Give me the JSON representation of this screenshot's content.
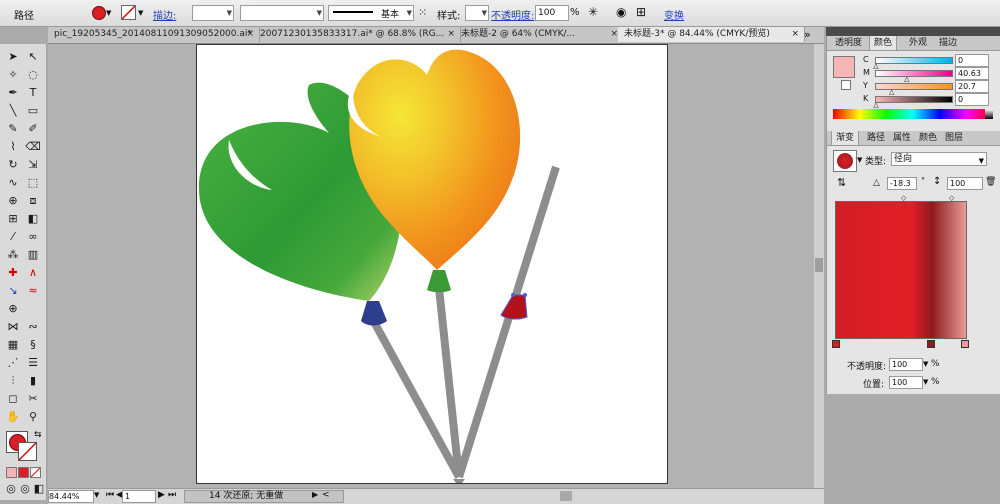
{
  "control_bar": {
    "object_label": "路径",
    "stroke_label": "描边:",
    "stroke_style": "基本",
    "style_label": "样式:",
    "opacity_label": "不透明度:",
    "opacity_value": "100",
    "opacity_unit": "%",
    "transform_label": "变换"
  },
  "doc_tabs": [
    {
      "label": "pic_19205345_20140811091309052000.ai*",
      "active": false
    },
    {
      "label": "20071230135833317.ai* @ 68.8% (RG...",
      "active": false
    },
    {
      "label": "未标题-2 @ 64% (CMYK/...",
      "active": false
    },
    {
      "label": "未标题-3* @ 84.44% (CMYK/预览)",
      "active": true
    }
  ],
  "tabs_overflow": "»",
  "status_bar": {
    "zoom": "84.44%",
    "page": "1",
    "history": "14 次还原; 无重做"
  },
  "color_panel": {
    "tabs": [
      "透明度",
      "颜色",
      "外观",
      "描边"
    ],
    "active_tab": "颜色",
    "channels": [
      {
        "name": "C",
        "value": "0",
        "level": 0.0
      },
      {
        "name": "M",
        "value": "40.63",
        "level": 0.4063
      },
      {
        "name": "Y",
        "value": "20.7",
        "level": 0.207
      },
      {
        "name": "K",
        "value": "0",
        "level": 0.0
      }
    ],
    "swatch_color": "#f7b5b6"
  },
  "gradient_panel": {
    "tabs": [
      "渐变",
      "路径",
      "属性",
      "颜色",
      "图层"
    ],
    "active_tab": "渐变",
    "type_label": "类型:",
    "type_value": "径向",
    "angle": "-18.3",
    "angle_unit": "°",
    "aspect": "100",
    "aspect_unit": "%",
    "opacity_label": "不透明度:",
    "opacity_value": "100",
    "opacity_unit": "%",
    "position_label": "位置:",
    "position_value": "100",
    "position_unit": "%",
    "stops": [
      "#d41d24",
      "#e21e26",
      "#8f1a1c",
      "#e89c98"
    ]
  },
  "colors": {
    "accent_red": "#d81f26",
    "balloon_green": "#3fa33a",
    "balloon_orange": "#f29018",
    "balloon_yellow": "#f2d12a",
    "stick_gray": "#8d8d8d",
    "knot_blue": "#2e3f8f",
    "knot_red": "#b3121a"
  }
}
